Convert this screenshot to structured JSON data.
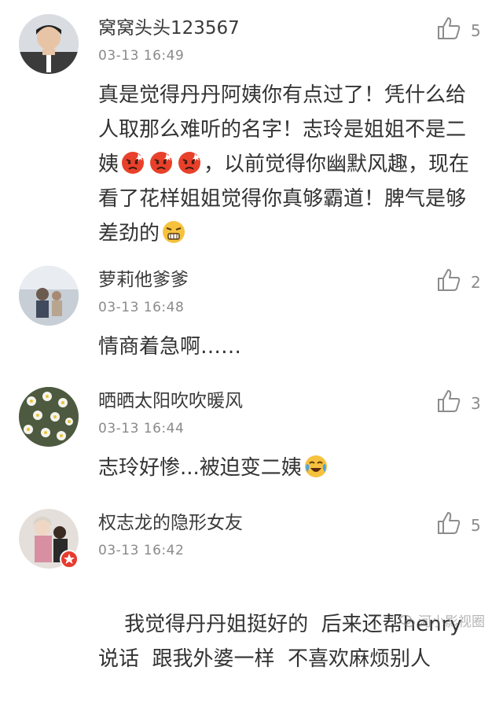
{
  "comments": [
    {
      "username": "窝窝头头123567",
      "time": "03-13 16:49",
      "likes": "5",
      "text_1": "真是觉得丹丹阿姨你有点过了！凭什么给人取那么难听的名字！志玲是姐姐不是二姨",
      "text_2": "，以前觉得你幽默风趣，现在看了花样姐姐觉得你真够霸道！脾气是够差劲的",
      "emojis": [
        "angry-face-icon",
        "angry-face-icon",
        "angry-face-icon",
        "grimace-face-icon"
      ]
    },
    {
      "username": "萝莉他爹爹",
      "time": "03-13 16:48",
      "likes": "2",
      "text_1": "情商着急啊……"
    },
    {
      "username": "晒晒太阳吹吹暖风",
      "time": "03-13 16:44",
      "likes": "3",
      "text_1": "志玲好惨...被迫变二姨",
      "emojis": [
        "laugh-cry-face-icon"
      ]
    },
    {
      "username": "权志龙的隐形女友",
      "time": "03-13 16:42",
      "likes": "5",
      "text_1": "我觉得丹丹姐挺好的  后来还帮henry说话  跟我外婆一样  不喜欢麻烦别人"
    }
  ],
  "watermark": {
    "text": "河小影视圈"
  },
  "colors": {
    "text": "#333333",
    "meta": "#8a8a8a",
    "divider": "#dcdcdc",
    "badge": "#e63b2e"
  }
}
